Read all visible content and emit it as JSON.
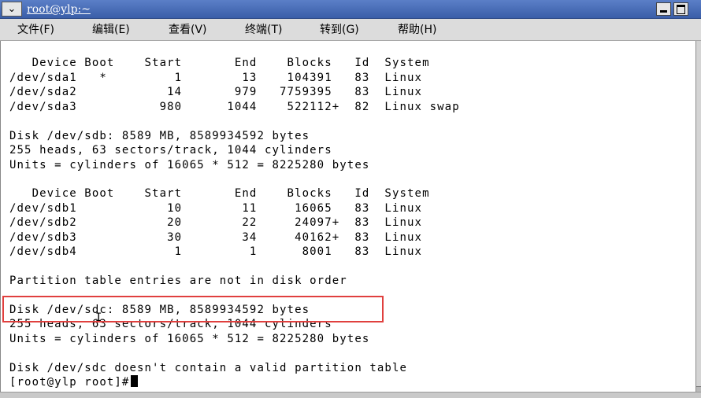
{
  "window": {
    "title": "root@ylp:~",
    "menu_glyph": "⌄"
  },
  "menubar": {
    "items": [
      "文件(F)",
      "编辑(E)",
      "查看(V)",
      "终端(T)",
      "转到(G)",
      "帮助(H)"
    ]
  },
  "terminal": {
    "lines": [
      "   Device Boot    Start       End    Blocks   Id  System",
      "/dev/sda1   *         1        13    104391   83  Linux",
      "/dev/sda2            14       979   7759395   83  Linux",
      "/dev/sda3           980      1044    522112+  82  Linux swap",
      "",
      "Disk /dev/sdb: 8589 MB, 8589934592 bytes",
      "255 heads, 63 sectors/track, 1044 cylinders",
      "Units = cylinders of 16065 * 512 = 8225280 bytes",
      "",
      "   Device Boot    Start       End    Blocks   Id  System",
      "/dev/sdb1            10        11     16065   83  Linux",
      "/dev/sdb2            20        22     24097+  83  Linux",
      "/dev/sdb3            30        34     40162+  83  Linux",
      "/dev/sdb4             1         1      8001   83  Linux",
      "",
      "Partition table entries are not in disk order",
      "",
      "Disk /dev/sdc: 8589 MB, 8589934592 bytes",
      "255 heads, 63 sectors/track, 1044 cylinders",
      "Units = cylinders of 16065 * 512 = 8225280 bytes",
      "",
      "Disk /dev/sdc doesn't contain a valid partition table",
      "[root@ylp root]#"
    ]
  },
  "annotation": {
    "color": "#e0403e"
  }
}
